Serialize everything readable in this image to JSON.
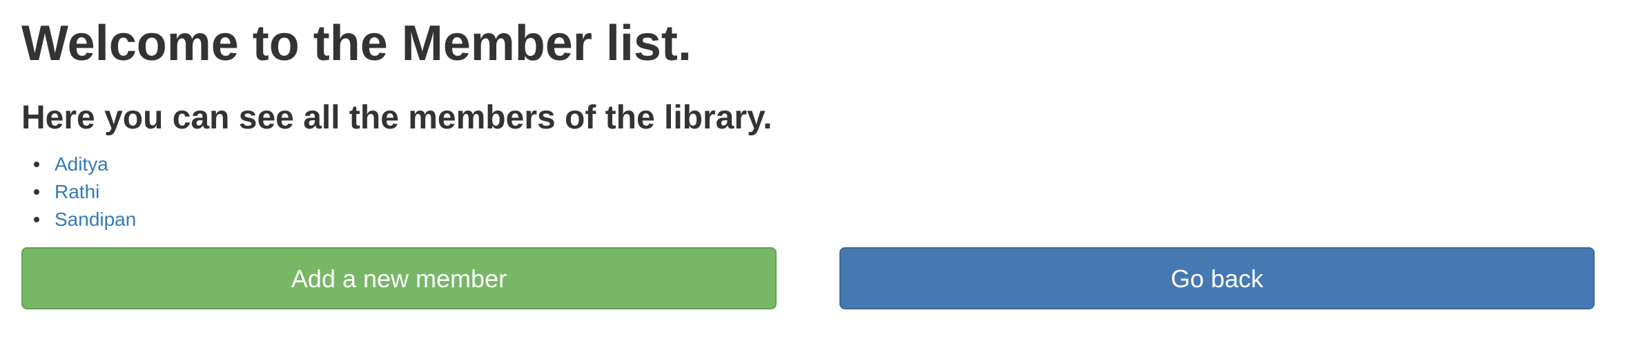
{
  "page": {
    "title": "Welcome to the Member list.",
    "subtitle": "Here you can see all the members of the library."
  },
  "members": [
    {
      "name": "Aditya"
    },
    {
      "name": "Rathi"
    },
    {
      "name": "Sandipan"
    }
  ],
  "actions": {
    "add_label": "Add a new member",
    "back_label": "Go back"
  },
  "colors": {
    "text": "#333333",
    "link": "#337ab7",
    "success": "#77b766",
    "primary": "#4679b2"
  }
}
